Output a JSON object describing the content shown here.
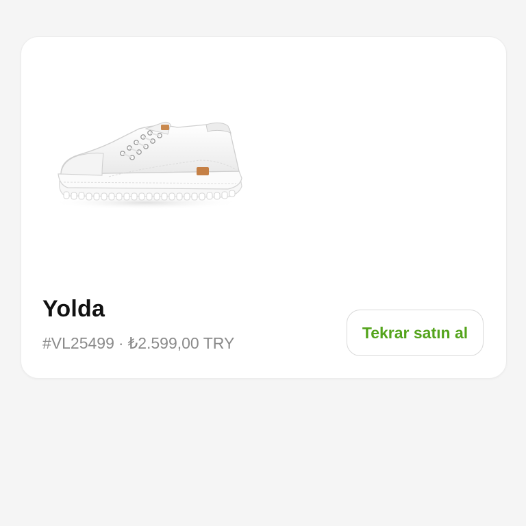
{
  "product": {
    "name": "Yolda",
    "code": "#VL25499",
    "separator": "·",
    "price": "₺2.599,00 TRY",
    "image_icon": "white-sneaker-image"
  },
  "actions": {
    "rebuy_label": "Tekrar satın al"
  },
  "colors": {
    "accent": "#54a41c",
    "card_background": "#ffffff",
    "page_background": "#f5f5f5",
    "muted_text": "#8a8a8a"
  }
}
